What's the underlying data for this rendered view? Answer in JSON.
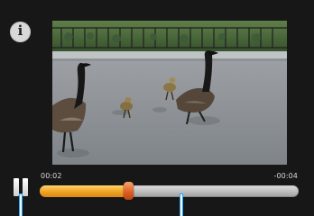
{
  "player": {
    "info_icon_glyph": "i",
    "time_elapsed": "00:02",
    "time_remaining": "-00:04",
    "progress_fraction": 0.34
  },
  "icons": {
    "info": "info-icon",
    "pause": "pause-icon"
  },
  "colors": {
    "background": "#171717",
    "progress_fill": "#f0a123",
    "thumb": "#dc5b23",
    "track": "#b5b5b5",
    "marker_outline": "#1ea7ff"
  }
}
